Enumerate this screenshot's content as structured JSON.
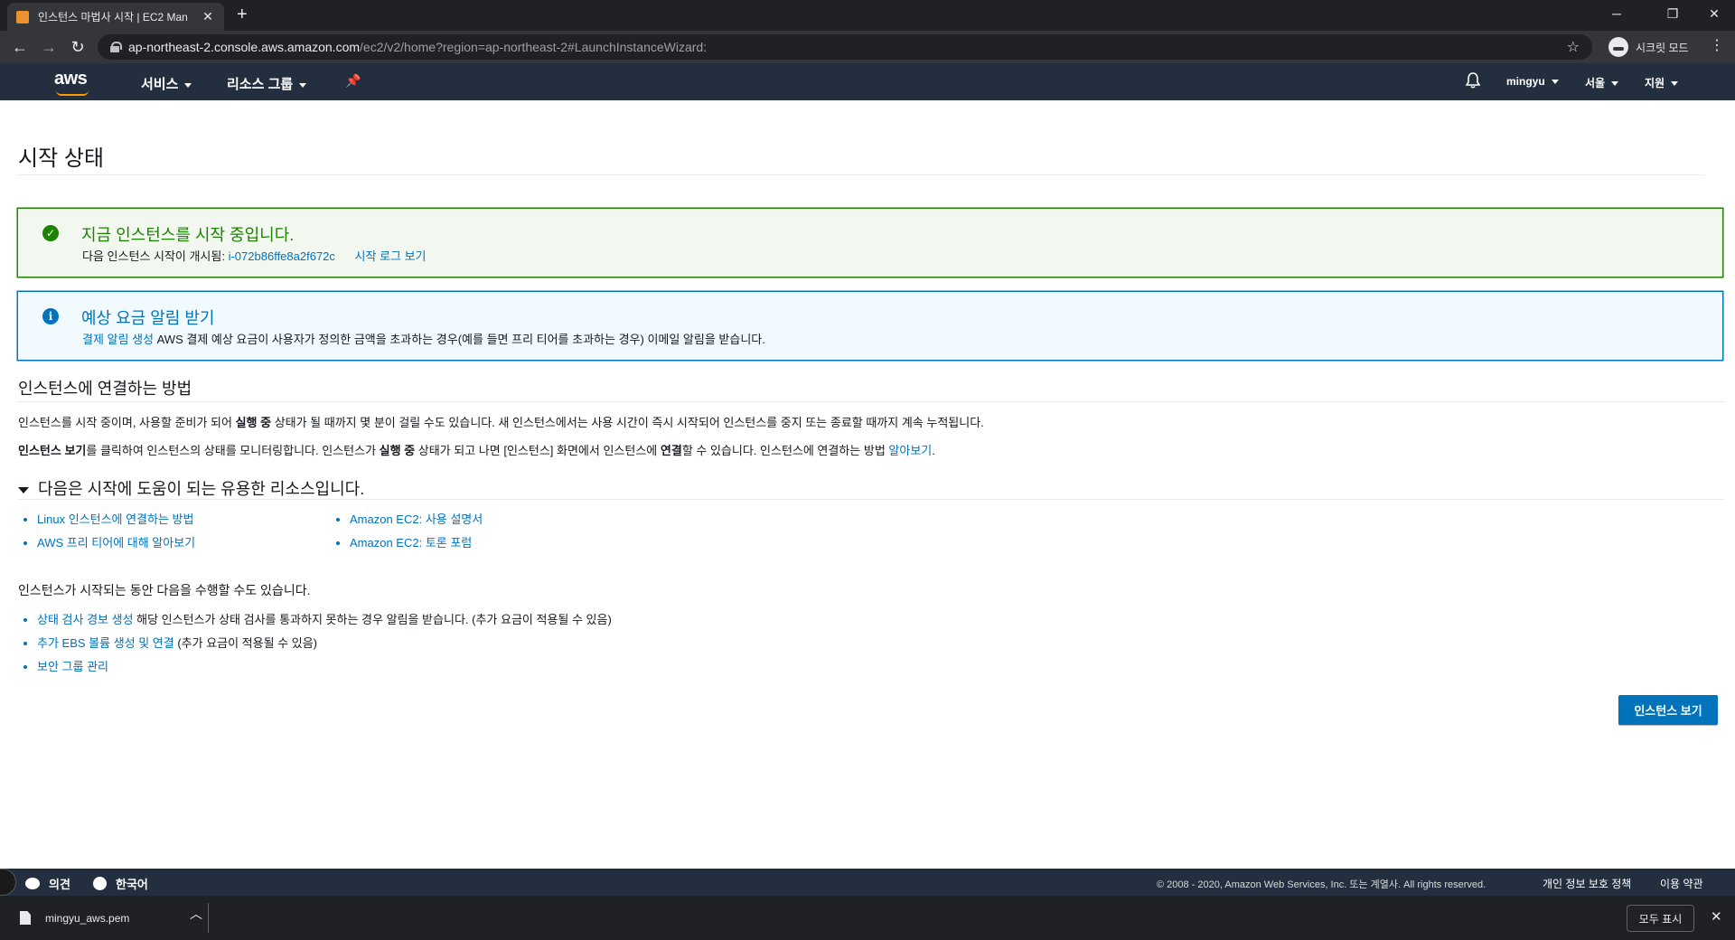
{
  "browser": {
    "tab_title": "인스턴스 마법사 시작 | EC2 Man",
    "url_host": "ap-northeast-2.console.aws.amazon.com",
    "url_path": "/ec2/v2/home?region=ap-northeast-2#LaunchInstanceWizard:",
    "incognito_label": "시크릿 모드"
  },
  "awsnav": {
    "logo": "aws",
    "services": "서비스",
    "resource_groups": "리소스 그룹",
    "user": "mingyu",
    "region": "서울",
    "support": "지원"
  },
  "page": {
    "title": "시작 상태"
  },
  "success_alert": {
    "heading": "지금 인스턴스를 시작 중입니다.",
    "body_prefix": "다음 인스턴스 시작이 개시됨:",
    "instance_id": "i-072b86ffe8a2f672c",
    "log_link": "시작 로그 보기"
  },
  "info_alert": {
    "heading": "예상 요금 알림 받기",
    "link": "결제 알림 생성",
    "body": "AWS 결제 예상 요금이 사용자가 정의한 금액을 초과하는 경우(예를 들면 프리 티어를 초과하는 경우) 이메일 알림을 받습니다."
  },
  "connect": {
    "title": "인스턴스에 연결하는 방법",
    "p1_a": "인스턴스를 시작 중이며, 사용할 준비가 되어 ",
    "p1_b": "실행 중",
    "p1_c": " 상태가 될 때까지 몇 분이 걸릴 수도 있습니다. 새 인스턴스에서는 사용 시간이 즉시 시작되어 인스턴스를 중지 또는 종료할 때까지 계속 누적됩니다.",
    "p2_a": "인스턴스 보기",
    "p2_b": "를 클릭하여 인스턴스의 상태를 모니터링합니다. 인스턴스가 ",
    "p2_c": "실행 중",
    "p2_d": " 상태가 되고 나면 [인스턴스] 화면에서 인스턴스에 ",
    "p2_e": "연결",
    "p2_f": "할 수 있습니다. 인스턴스에 연결하는 방법 ",
    "p2_link": "알아보기",
    "p2_end": "."
  },
  "resources": {
    "title": "다음은 시작에 도움이 되는 유용한 리소스입니다.",
    "left": [
      "Linux 인스턴스에 연결하는 방법",
      "AWS 프리 티어에 대해 알아보기"
    ],
    "right": [
      "Amazon EC2: 사용 설명서",
      "Amazon EC2: 토론 포럼"
    ]
  },
  "while_launch": {
    "title": "인스턴스가 시작되는 동안 다음을 수행할 수도 있습니다.",
    "item1_link": "상태 검사 경보 생성",
    "item1_text": " 해당 인스턴스가 상태 검사를 통과하지 못하는 경우 알림을 받습니다. (추가 요금이 적용될 수 있음)",
    "item2_link": "추가 EBS 볼륨 생성 및 연결",
    "item2_text": " (추가 요금이 적용될 수 있음)",
    "item3_link": "보안 그룹 관리"
  },
  "view_instances_button": "인스턴스 보기",
  "footer": {
    "feedback": "의견",
    "language": "한국어",
    "copyright": "© 2008 - 2020, Amazon Web Services, Inc. 또는 계열사. All rights reserved.",
    "privacy": "개인 정보 보호 정책",
    "terms": "이용 약관"
  },
  "downloads": {
    "file": "mingyu_aws.pem",
    "show_all": "모두 표시"
  }
}
